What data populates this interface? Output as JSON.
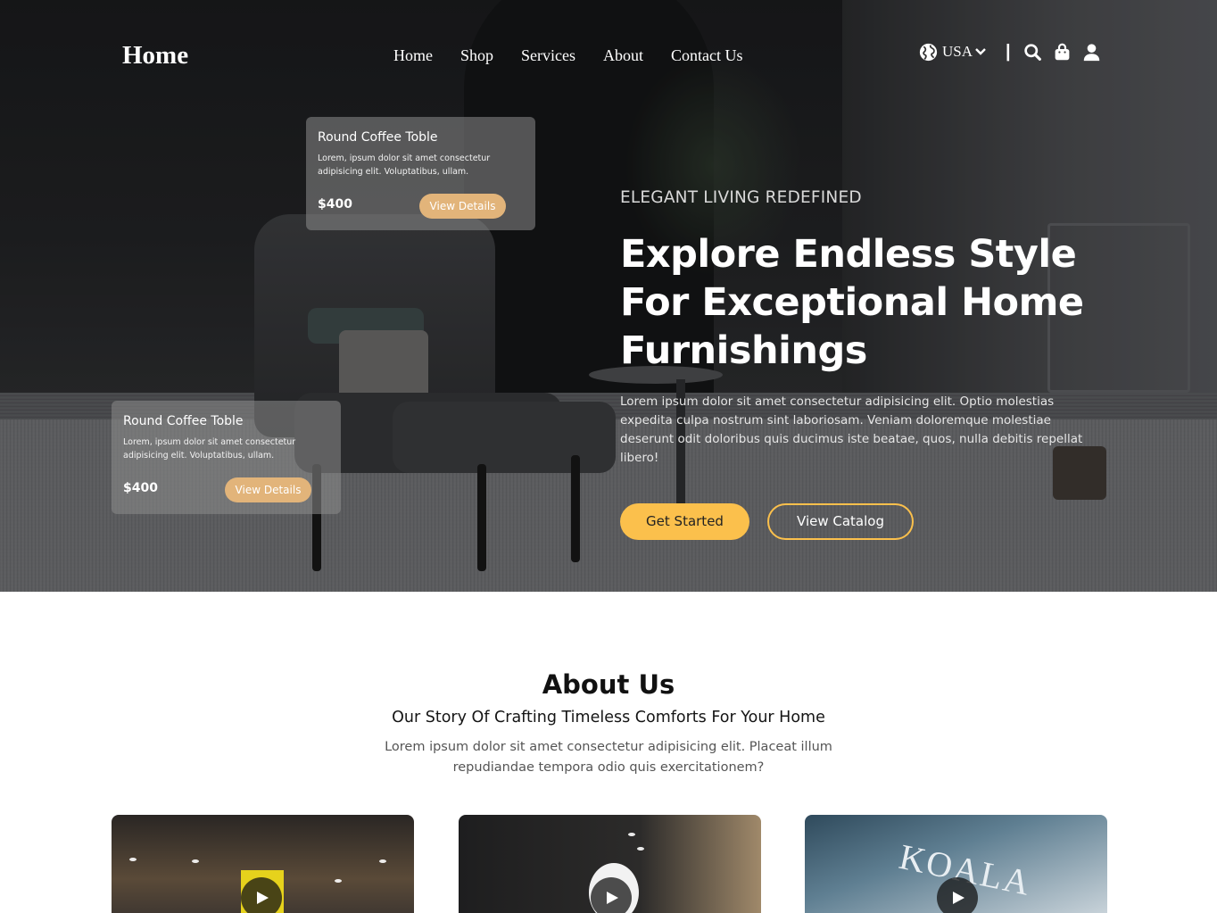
{
  "brand": "Home",
  "nav": {
    "items": [
      "Home",
      "Shop",
      "Services",
      "About",
      "Contact Us"
    ],
    "currency": "USA",
    "divider": "|",
    "icons": [
      "globe-icon",
      "chevron-down-icon",
      "search-icon",
      "shopping-bag-icon",
      "user-icon"
    ]
  },
  "cards": [
    {
      "title": "Round Coffee Toble",
      "desc": "Lorem, ipsum dolor sit amet consectetur adipisicing elit. Voluptatibus, ullam.",
      "price": "$400",
      "button": "View Details"
    },
    {
      "title": "Round Coffee Toble",
      "desc": "Lorem, ipsum dolor sit amet consectetur adipisicing elit. Voluptatibus, ullam.",
      "price": "$400",
      "button": "View Details"
    }
  ],
  "hero": {
    "eyebrow": "ELEGANT LIVING REDEFINED",
    "headline": "Explore Endless Style For Exceptional Home Furnishings",
    "description": "Lorem ipsum dolor sit amet consectetur adipisicing elit. Optio molestias expedita culpa nostrum sint laboriosam. Veniam doloremque molestiae deserunt odit doloribus quis ducimus iste beatae, quos, nulla debitis repellat libero!",
    "primary_button": "Get Started",
    "secondary_button": "View Catalog"
  },
  "about": {
    "title": "About Us",
    "subtitle": "Our Story Of Crafting Timeless Comforts For Your Home",
    "description": "Lorem ipsum dolor sit amet consectetur adipisicing elit. Placeat illum repudiandae tempora odio quis exercitationem?",
    "video_sign": "KOALA"
  },
  "colors": {
    "accent": "#fbc04c",
    "card_button": "#e2b47a",
    "text_dark": "#111111"
  }
}
